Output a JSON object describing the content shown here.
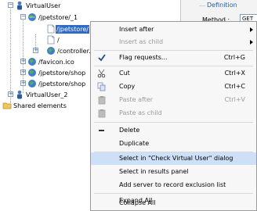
{
  "tree": {
    "nodes": [
      {
        "label": "VirtualUser",
        "icon": "virtual-user-icon",
        "expander": "−"
      },
      {
        "label": "/jpetstore/_1",
        "icon": "globe-icon",
        "expander": "−"
      },
      {
        "label": "/jpetstore/",
        "icon": "page-icon",
        "expander": ""
      },
      {
        "label": "/",
        "icon": "page-icon",
        "expander": ""
      },
      {
        "label": "/controller.",
        "icon": "globe-icon",
        "expander": "+"
      },
      {
        "label": "/favicon.ico",
        "icon": "globe-icon",
        "expander": "+"
      },
      {
        "label": "/jpetstore/shop",
        "icon": "globe-icon",
        "expander": "+"
      },
      {
        "label": "/jpetstore/shop",
        "icon": "globe-icon",
        "expander": "+"
      },
      {
        "label": "VirtualUser_2",
        "icon": "virtual-user-icon",
        "expander": "+"
      },
      {
        "label": "Shared elements",
        "icon": "folder-icon",
        "expander": ""
      }
    ]
  },
  "definition": {
    "title": "Definition",
    "method_label": "Method :",
    "method_value": "GET"
  },
  "context_menu": {
    "items": [
      {
        "label": "Insert after",
        "shortcut": "",
        "submenu": true,
        "disabled": false,
        "icon": ""
      },
      {
        "label": "Insert as child",
        "shortcut": "",
        "submenu": true,
        "disabled": true,
        "icon": ""
      },
      {
        "label": "Flag requests...",
        "shortcut": "Ctrl+G",
        "submenu": false,
        "disabled": false,
        "icon": "checkmark-icon"
      },
      {
        "label": "Cut",
        "shortcut": "Ctrl+X",
        "submenu": false,
        "disabled": false,
        "icon": "scissors-icon"
      },
      {
        "label": "Copy",
        "shortcut": "Ctrl+C",
        "submenu": false,
        "disabled": false,
        "icon": "copy-icon"
      },
      {
        "label": "Paste after",
        "shortcut": "Ctrl+V",
        "submenu": false,
        "disabled": true,
        "icon": "paste-icon"
      },
      {
        "label": "Paste as child",
        "shortcut": "",
        "submenu": false,
        "disabled": true,
        "icon": "paste-icon"
      },
      {
        "label": "Delete",
        "shortcut": "",
        "submenu": false,
        "disabled": false,
        "icon": "minus-icon"
      },
      {
        "label": "Duplicate",
        "shortcut": "",
        "submenu": false,
        "disabled": false,
        "icon": ""
      },
      {
        "label": "Select in \"Check Virtual User\" dialog",
        "shortcut": "",
        "submenu": false,
        "disabled": false,
        "icon": "",
        "highlighted": true
      },
      {
        "label": "Select in results panel",
        "shortcut": "",
        "submenu": false,
        "disabled": false,
        "icon": ""
      },
      {
        "label": "Add server to record exclusion list",
        "shortcut": "",
        "submenu": false,
        "disabled": false,
        "icon": ""
      },
      {
        "label": "Expand All",
        "shortcut": "",
        "submenu": false,
        "disabled": false,
        "icon": ""
      },
      {
        "label": "Collapse All",
        "shortcut": "",
        "submenu": false,
        "disabled": false,
        "icon": ""
      }
    ]
  },
  "colors": {
    "selection": "#316ac5",
    "menu_highlight": "#cde0f7",
    "definition_title": "#215cb0"
  }
}
